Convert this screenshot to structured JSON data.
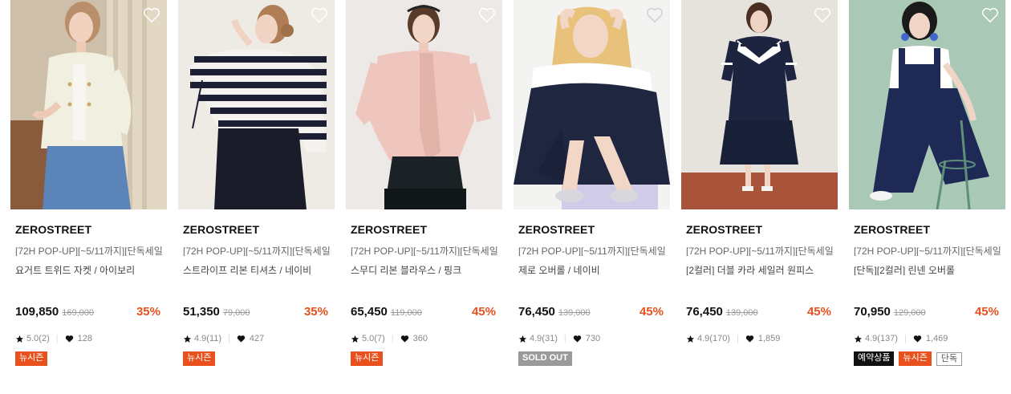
{
  "products": [
    {
      "brand": "ZEROSTREET",
      "tag": "[72H POP-UP][~5/11까지][단독세일]",
      "name": "요거트 트위드 자켓 / 아이보리",
      "price": "109,850",
      "original_price": "169,000",
      "discount": "35%",
      "rating": "5.0(2)",
      "likes": "128",
      "badges": [
        "뉴시즌"
      ]
    },
    {
      "brand": "ZEROSTREET",
      "tag": "[72H POP-UP][~5/11까지][단독세일]...",
      "name": "스트라이프 리본 티셔츠 / 네이비",
      "price": "51,350",
      "original_price": "79,000",
      "discount": "35%",
      "rating": "4.9(11)",
      "likes": "427",
      "badges": [
        "뉴시즌"
      ]
    },
    {
      "brand": "ZEROSTREET",
      "tag": "[72H POP-UP][~5/11까지][단독세일]...",
      "name": "스무디 리본 블라우스 / 핑크",
      "price": "65,450",
      "original_price": "119,000",
      "discount": "45%",
      "rating": "5.0(7)",
      "likes": "360",
      "badges": [
        "뉴시즌"
      ]
    },
    {
      "brand": "ZEROSTREET",
      "tag": "[72H POP-UP][~5/11까지][단독세일]",
      "name": "제로 오버롤 / 네이비",
      "price": "76,450",
      "original_price": "139,000",
      "discount": "45%",
      "rating": "4.9(31)",
      "likes": "730",
      "badges": [
        "SOLD OUT"
      ]
    },
    {
      "brand": "ZEROSTREET",
      "tag": "[72H POP-UP][~5/11까지][단독세일]...",
      "name": "[2컬러] 더블 카라 세일러 원피스",
      "price": "76,450",
      "original_price": "139,000",
      "discount": "45%",
      "rating": "4.9(170)",
      "likes": "1,859",
      "badges": []
    },
    {
      "brand": "ZEROSTREET",
      "tag": "[72H POP-UP][~5/11까지][단독세일]...",
      "name": "[단독][2컬러] 린넨 오버롤",
      "price": "70,950",
      "original_price": "129,000",
      "discount": "45%",
      "rating": "4.9(137)",
      "likes": "1,469",
      "badges": [
        "예약상품",
        "뉴시즌",
        "단독"
      ]
    }
  ],
  "colors": {
    "discount": "#e8501e",
    "badge_new_season": "#e8501e",
    "badge_sold_out": "#9a9a9a",
    "badge_reserve": "#111111"
  },
  "icons": {
    "wishlist": "heart-outline-icon",
    "rating": "star-icon",
    "likes": "heart-filled-icon"
  }
}
